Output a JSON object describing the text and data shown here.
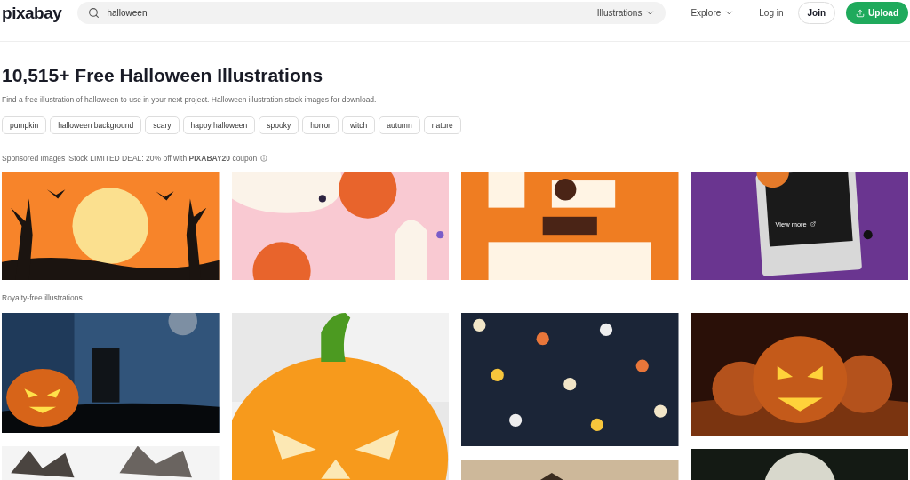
{
  "header": {
    "logo": "pixabay",
    "search": {
      "value": "halloween",
      "filter": "Illustrations"
    },
    "explore": "Explore",
    "login": "Log in",
    "join": "Join",
    "upload": "Upload"
  },
  "title": "10,515+ Free Halloween Illustrations",
  "description": "Find a free illustration of halloween to use in your next project. Halloween illustration stock images for download.",
  "tags": [
    "pumpkin",
    "halloween background",
    "scary",
    "happy halloween",
    "spooky",
    "horror",
    "witch",
    "autumn",
    "nature"
  ],
  "sponsored": {
    "text": "Sponsored Images iStock LIMITED DEAL: 20% off with **PIXABAY20** coupon",
    "view_more": "View more"
  },
  "royalty_free": "Royalty-free illustrations"
}
